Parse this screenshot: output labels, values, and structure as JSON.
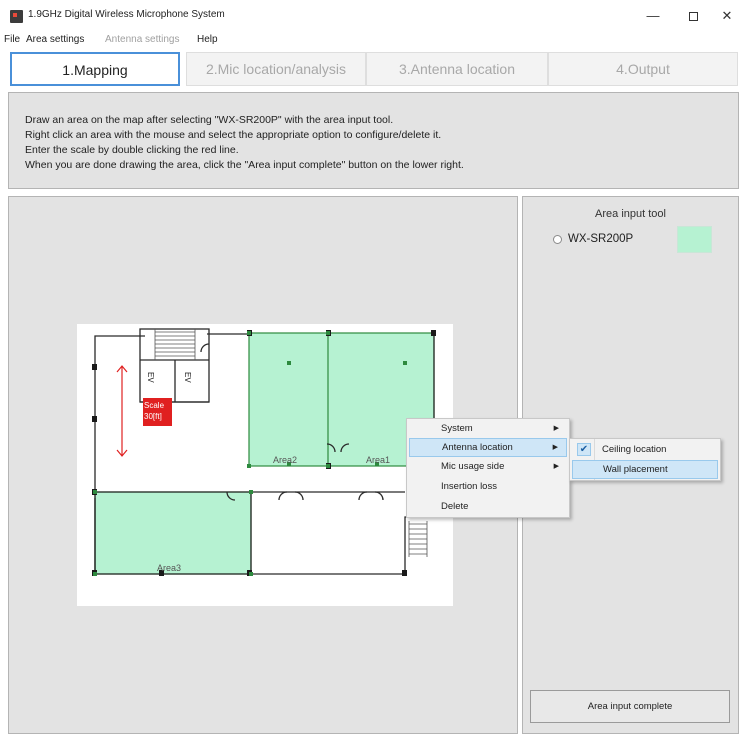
{
  "window": {
    "title": "1.9GHz Digital Wireless Microphone System",
    "controls": {
      "minimize": "—",
      "close": "✕"
    }
  },
  "menu": [
    {
      "label": "File",
      "enabled": true
    },
    {
      "label": "Area settings",
      "enabled": true
    },
    {
      "label": "Antenna settings",
      "enabled": false
    },
    {
      "label": "Help",
      "enabled": true
    }
  ],
  "tabs": [
    {
      "label": "1.Mapping",
      "active": true
    },
    {
      "label": "2.Mic location/analysis",
      "active": false
    },
    {
      "label": "3.Antenna location",
      "active": false
    },
    {
      "label": "4.Output",
      "active": false
    }
  ],
  "instructions": [
    "Draw an area on the map after selecting \"WX-SR200P\" with the area input tool.",
    "Right click an area with the mouse and select the appropriate option to configure/delete it.",
    "Enter the scale by double clicking the red line.",
    "When you are done drawing the area, click the \"Area input complete\" button on the lower right."
  ],
  "map": {
    "ev_label": "EV",
    "scale_label_line1": "Scale",
    "scale_label_line2": "30[ft]",
    "areas": [
      "Area1",
      "Area2",
      "Area3"
    ],
    "colors": {
      "area_fill": "#b6f2d2",
      "area_border": "#2d8a3e",
      "scale": "#e02020"
    }
  },
  "area_tool": {
    "title": "Area input tool",
    "option": "WX-SR200P",
    "swatch_color": "#b6f2d2",
    "complete_button": "Area input complete"
  },
  "context_menu": {
    "items": [
      {
        "label": "System",
        "submenu": true
      },
      {
        "label": "Antenna location",
        "submenu": true,
        "highlighted": true
      },
      {
        "label": "Mic usage side",
        "submenu": true
      },
      {
        "label": "Insertion loss",
        "submenu": false
      },
      {
        "label": "Delete",
        "submenu": false
      }
    ],
    "submenu": [
      {
        "label": "Ceiling location",
        "checked": true
      },
      {
        "label": "Wall placement",
        "highlighted": true
      }
    ]
  }
}
